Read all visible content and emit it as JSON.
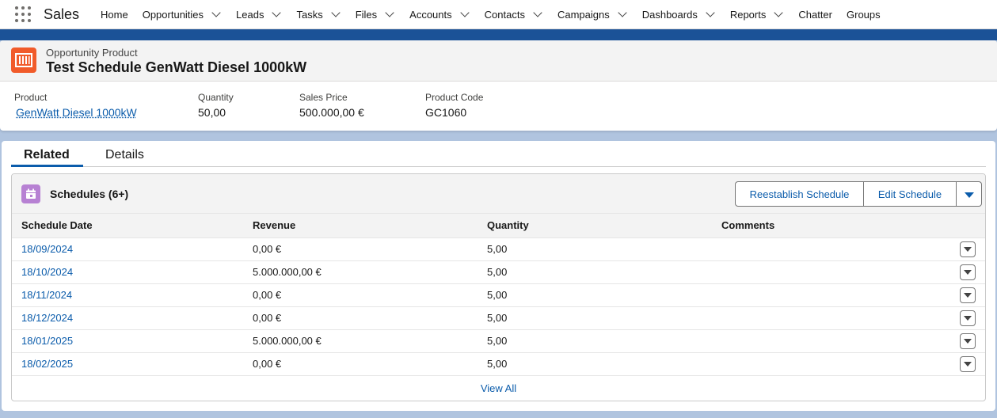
{
  "nav": {
    "app_name": "Sales",
    "items": [
      {
        "label": "Home",
        "has_menu": false
      },
      {
        "label": "Opportunities",
        "has_menu": true
      },
      {
        "label": "Leads",
        "has_menu": true
      },
      {
        "label": "Tasks",
        "has_menu": true
      },
      {
        "label": "Files",
        "has_menu": true
      },
      {
        "label": "Accounts",
        "has_menu": true
      },
      {
        "label": "Contacts",
        "has_menu": true
      },
      {
        "label": "Campaigns",
        "has_menu": true
      },
      {
        "label": "Dashboards",
        "has_menu": true
      },
      {
        "label": "Reports",
        "has_menu": true
      },
      {
        "label": "Chatter",
        "has_menu": false
      },
      {
        "label": "Groups",
        "has_menu": false
      }
    ]
  },
  "record": {
    "object_type": "Opportunity Product",
    "title": "Test Schedule GenWatt Diesel 1000kW",
    "icon": "product-icon",
    "fields": {
      "product": {
        "label": "Product",
        "value": "GenWatt Diesel 1000kW"
      },
      "quantity": {
        "label": "Quantity",
        "value": "50,00"
      },
      "sales_price": {
        "label": "Sales Price",
        "value": "500.000,00 €"
      },
      "product_code": {
        "label": "Product Code",
        "value": "GC1060"
      }
    }
  },
  "tabs": {
    "related": "Related",
    "details": "Details"
  },
  "schedules": {
    "title": "Schedules (6+)",
    "icon": "calendar-icon",
    "buttons": {
      "reestablish": "Reestablish Schedule",
      "edit": "Edit Schedule"
    },
    "columns": [
      "Schedule Date",
      "Revenue",
      "Quantity",
      "Comments"
    ],
    "rows": [
      {
        "date": "18/09/2024",
        "revenue": "0,00 €",
        "quantity": "5,00",
        "comments": ""
      },
      {
        "date": "18/10/2024",
        "revenue": "5.000.000,00 €",
        "quantity": "5,00",
        "comments": ""
      },
      {
        "date": "18/11/2024",
        "revenue": "0,00 €",
        "quantity": "5,00",
        "comments": ""
      },
      {
        "date": "18/12/2024",
        "revenue": "0,00 €",
        "quantity": "5,00",
        "comments": ""
      },
      {
        "date": "18/01/2025",
        "revenue": "5.000.000,00 €",
        "quantity": "5,00",
        "comments": ""
      },
      {
        "date": "18/02/2025",
        "revenue": "0,00 €",
        "quantity": "5,00",
        "comments": ""
      }
    ],
    "view_all": "View All"
  },
  "colors": {
    "brand_band": "#1b5297",
    "link": "#0b5cab",
    "product_icon": "#f15b2a",
    "calendar_icon": "#b781d3"
  }
}
